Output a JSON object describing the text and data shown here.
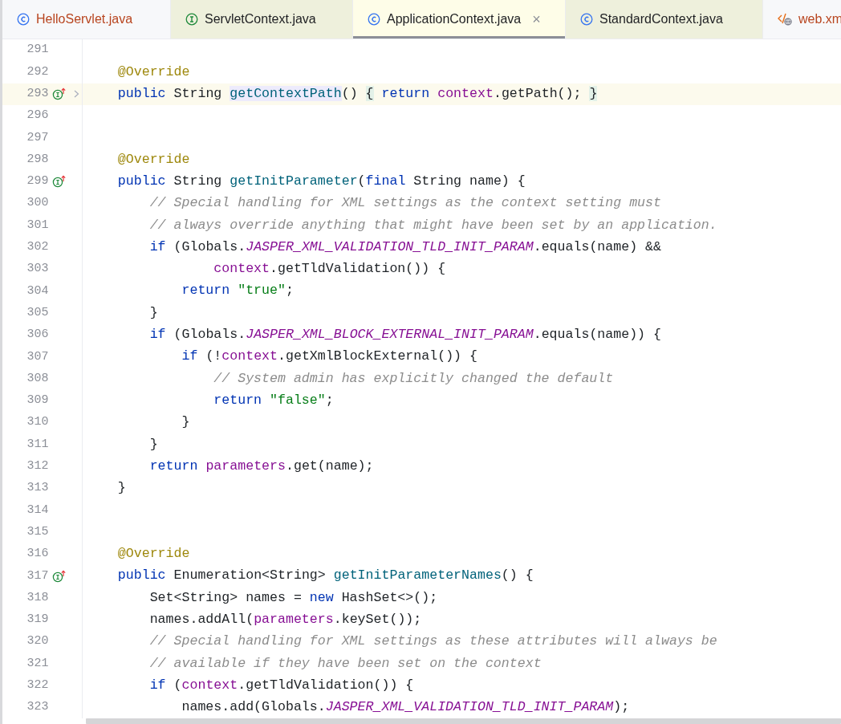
{
  "tabs": [
    {
      "label": "HelloServlet.java",
      "kind": "class",
      "selected": false,
      "modified": true,
      "color": "#f7f8fa"
    },
    {
      "label": "ServletContext.java",
      "kind": "interface",
      "selected": false,
      "modified": false,
      "color": "#eef0dc"
    },
    {
      "label": "ApplicationContext.java",
      "kind": "class",
      "selected": true,
      "modified": false,
      "color": "#fefde8",
      "close": "×"
    },
    {
      "label": "StandardContext.java",
      "kind": "class",
      "selected": false,
      "modified": false,
      "color": "#eef0dc"
    },
    {
      "label": "web.xm",
      "kind": "xml",
      "selected": false,
      "modified": true,
      "color": "#f7f8fa"
    }
  ],
  "lines": [
    {
      "number": "291"
    },
    {
      "number": "292",
      "tokens": [
        {
          "text": "    @Override",
          "kind": "annotation"
        }
      ]
    },
    {
      "number": "293",
      "current": true,
      "implements": true,
      "folded": true,
      "tokens": [
        {
          "text": "    public",
          "kind": "keyword"
        },
        {
          "text": " String "
        },
        {
          "text": "getContextPath",
          "kind": "declaration-highlight"
        },
        {
          "text": "() "
        },
        {
          "text": "{",
          "kind": "brace-highlight"
        },
        {
          "text": " return",
          "kind": "keyword"
        },
        {
          "text": " context",
          "kind": "field"
        },
        {
          "text": ".getPath(); "
        },
        {
          "text": "}",
          "kind": "brace-highlight"
        }
      ]
    },
    {
      "number": "296"
    },
    {
      "number": "297"
    },
    {
      "number": "298",
      "tokens": [
        {
          "text": "    @Override",
          "kind": "annotation"
        }
      ]
    },
    {
      "number": "299",
      "implements": true,
      "tokens": [
        {
          "text": "    public",
          "kind": "keyword"
        },
        {
          "text": " String "
        },
        {
          "text": "getInitParameter",
          "kind": "declaration"
        },
        {
          "text": "("
        },
        {
          "text": "final",
          "kind": "keyword"
        },
        {
          "text": " String name) {"
        }
      ]
    },
    {
      "number": "300",
      "tokens": [
        {
          "text": "        // Special handling for XML settings as the context setting must",
          "kind": "comment"
        }
      ]
    },
    {
      "number": "301",
      "tokens": [
        {
          "text": "        // always override anything that might have been set by an application.",
          "kind": "comment"
        }
      ]
    },
    {
      "number": "302",
      "tokens": [
        {
          "text": "        if",
          "kind": "keyword"
        },
        {
          "text": " (Globals."
        },
        {
          "text": "JASPER_XML_VALIDATION_TLD_INIT_PARAM",
          "kind": "constant"
        },
        {
          "text": ".equals(name) &&"
        }
      ]
    },
    {
      "number": "303",
      "tokens": [
        {
          "text": "                context",
          "kind": "field"
        },
        {
          "text": ".getTldValidation()) {"
        }
      ]
    },
    {
      "number": "304",
      "tokens": [
        {
          "text": "            return",
          "kind": "keyword"
        },
        {
          "text": " \"true\"",
          "kind": "string"
        },
        {
          "text": ";"
        }
      ]
    },
    {
      "number": "305",
      "tokens": [
        {
          "text": "        }"
        }
      ]
    },
    {
      "number": "306",
      "tokens": [
        {
          "text": "        if",
          "kind": "keyword"
        },
        {
          "text": " (Globals."
        },
        {
          "text": "JASPER_XML_BLOCK_EXTERNAL_INIT_PARAM",
          "kind": "constant"
        },
        {
          "text": ".equals(name)) {"
        }
      ]
    },
    {
      "number": "307",
      "tokens": [
        {
          "text": "            if",
          "kind": "keyword"
        },
        {
          "text": " (!"
        },
        {
          "text": "context",
          "kind": "field"
        },
        {
          "text": ".getXmlBlockExternal()) {"
        }
      ]
    },
    {
      "number": "308",
      "tokens": [
        {
          "text": "                // System admin has explicitly changed the default",
          "kind": "comment"
        }
      ]
    },
    {
      "number": "309",
      "tokens": [
        {
          "text": "                return",
          "kind": "keyword"
        },
        {
          "text": " \"false\"",
          "kind": "string"
        },
        {
          "text": ";"
        }
      ]
    },
    {
      "number": "310",
      "tokens": [
        {
          "text": "            }"
        }
      ]
    },
    {
      "number": "311",
      "tokens": [
        {
          "text": "        }"
        }
      ]
    },
    {
      "number": "312",
      "tokens": [
        {
          "text": "        return",
          "kind": "keyword"
        },
        {
          "text": " parameters",
          "kind": "field"
        },
        {
          "text": ".get(name);"
        }
      ]
    },
    {
      "number": "313",
      "tokens": [
        {
          "text": "    }"
        }
      ]
    },
    {
      "number": "314"
    },
    {
      "number": "315"
    },
    {
      "number": "316",
      "tokens": [
        {
          "text": "    @Override",
          "kind": "annotation"
        }
      ]
    },
    {
      "number": "317",
      "implements": true,
      "tokens": [
        {
          "text": "    public",
          "kind": "keyword"
        },
        {
          "text": " Enumeration<String> "
        },
        {
          "text": "getInitParameterNames",
          "kind": "declaration"
        },
        {
          "text": "() {"
        }
      ]
    },
    {
      "number": "318",
      "tokens": [
        {
          "text": "        Set<String> names = "
        },
        {
          "text": "new",
          "kind": "keyword"
        },
        {
          "text": " HashSet<>();"
        }
      ]
    },
    {
      "number": "319",
      "tokens": [
        {
          "text": "        names.addAll("
        },
        {
          "text": "parameters",
          "kind": "field"
        },
        {
          "text": ".keySet());"
        }
      ]
    },
    {
      "number": "320",
      "tokens": [
        {
          "text": "        // Special handling for XML settings as these attributes will always be",
          "kind": "comment"
        }
      ]
    },
    {
      "number": "321",
      "tokens": [
        {
          "text": "        // available if they have been set on the context",
          "kind": "comment"
        }
      ]
    },
    {
      "number": "322",
      "tokens": [
        {
          "text": "        if",
          "kind": "keyword"
        },
        {
          "text": " ("
        },
        {
          "text": "context",
          "kind": "field"
        },
        {
          "text": ".getTldValidation()) {"
        }
      ]
    },
    {
      "number": "323",
      "tokens": [
        {
          "text": "            names.add(Globals."
        },
        {
          "text": "JASPER_XML_VALIDATION_TLD_INIT_PARAM",
          "kind": "constant"
        },
        {
          "text": ");"
        }
      ]
    }
  ]
}
